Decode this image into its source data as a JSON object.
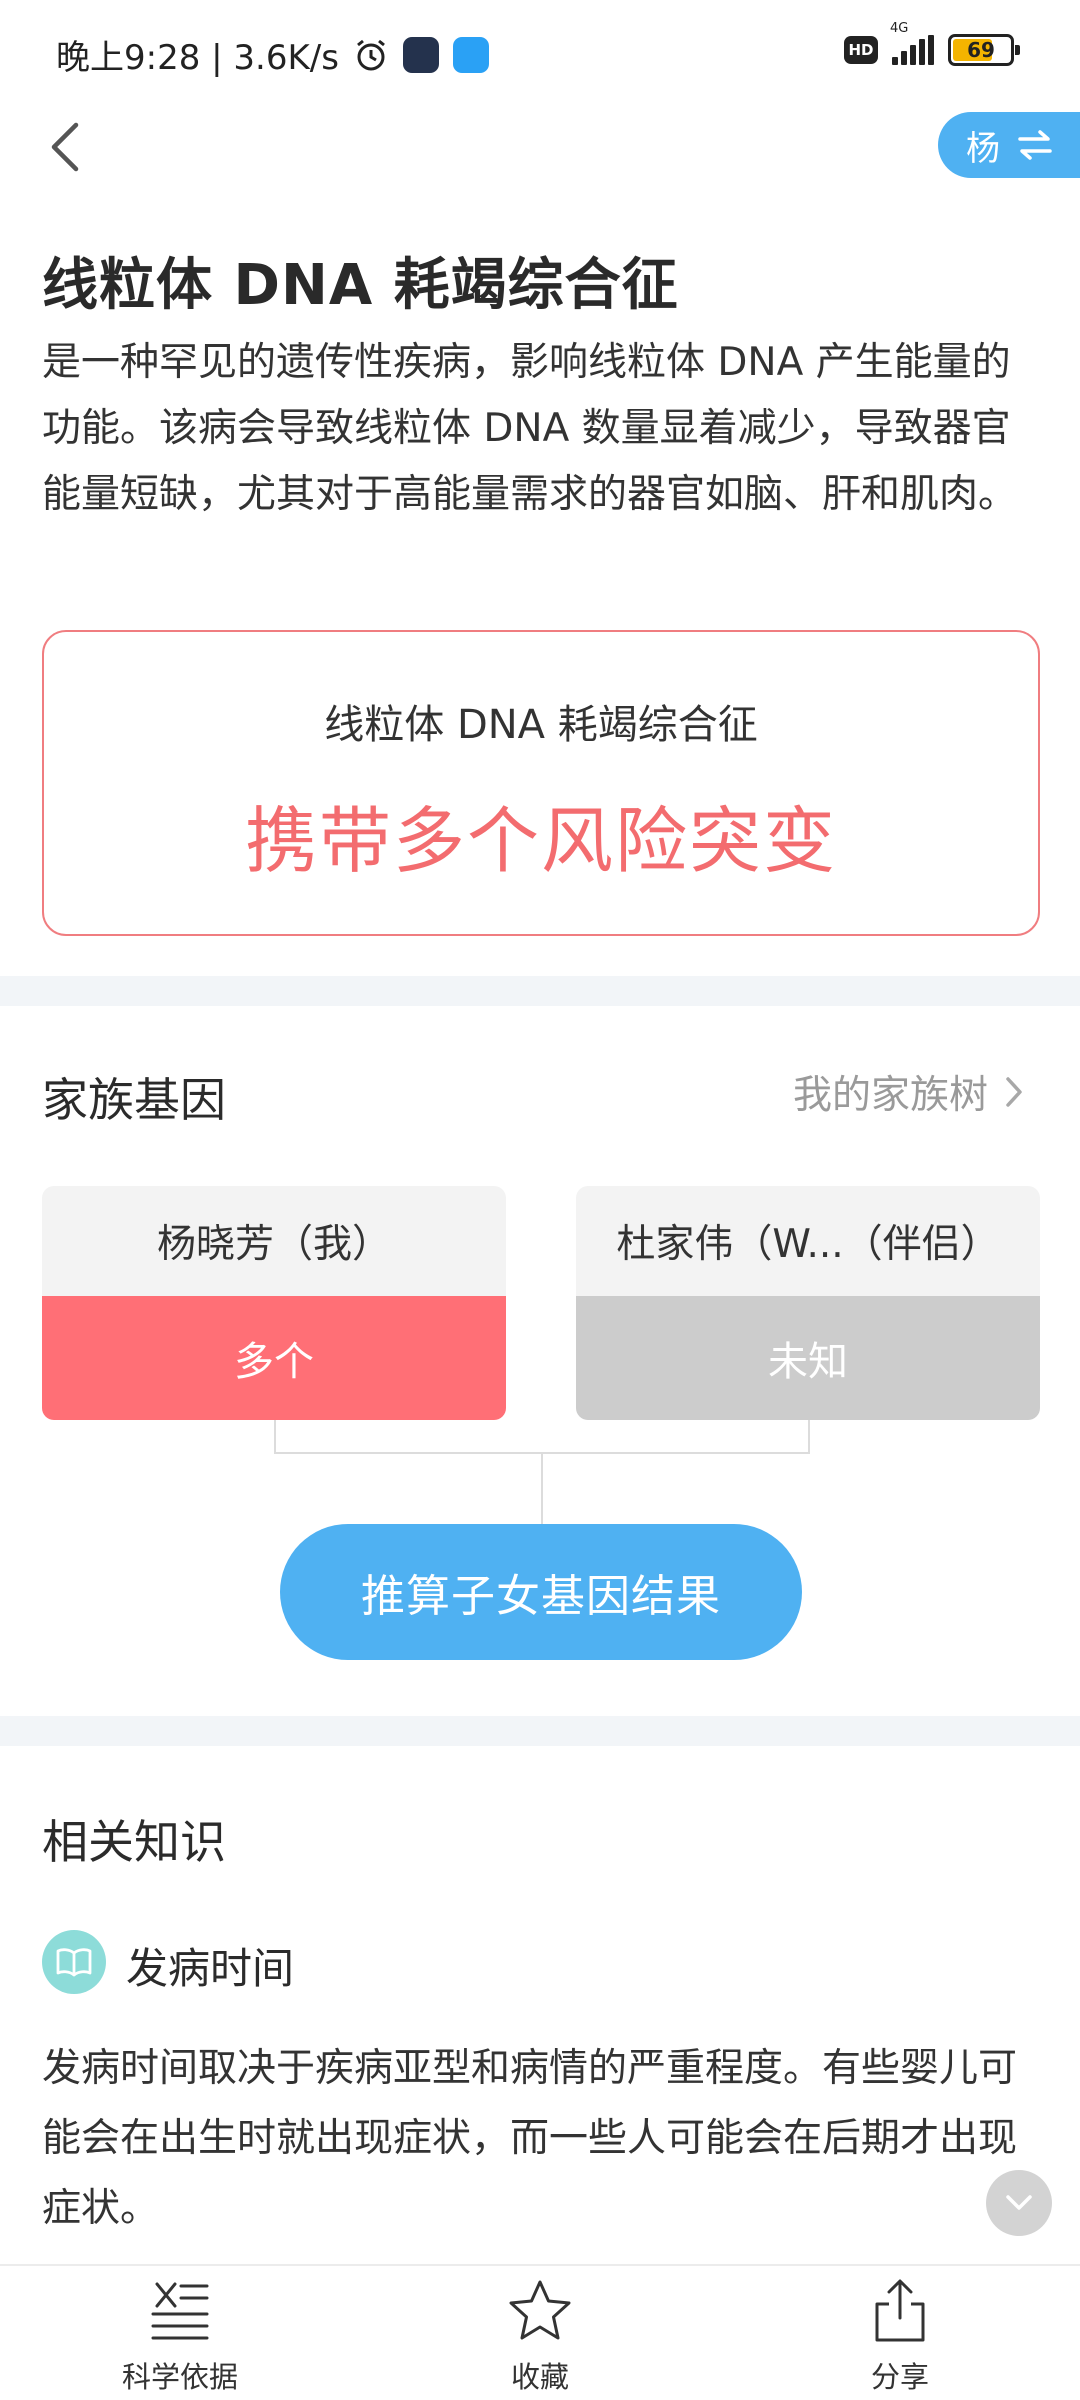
{
  "status_bar": {
    "time": "晚上9:28 | 3.6K/s",
    "hd": "HD",
    "network": "4G",
    "battery": "69",
    "battery_level": 0.69
  },
  "header": {
    "user_switch_label": "杨"
  },
  "disease": {
    "title": "线粒体 DNA 耗竭综合征",
    "description": "是一种罕见的遗传性疾病，影响线粒体 DNA 产生能量的功能。该病会导致线粒体 DNA 数量显着减少，导致器官能量短缺，尤其对于高能量需求的器官如脑、肝和肌肉。"
  },
  "risk_card": {
    "name": "线粒体 DNA 耗竭综合征",
    "status": "携带多个风险突变",
    "status_color": "#f36c6f"
  },
  "family": {
    "title": "家族基因",
    "tree_link": "我的家族树",
    "members": [
      {
        "name": "杨晓芳（我）",
        "status": "多个",
        "color": "#ff6f76"
      },
      {
        "name": "杜家伟（W...（伴侣）",
        "status": "未知",
        "color": "#cccccc"
      }
    ],
    "predict_button": "推算子女基因结果"
  },
  "knowledge": {
    "title": "相关知识",
    "items": [
      {
        "icon": "book-icon",
        "title": "发病时间",
        "text": "发病时间取决于疾病亚型和病情的严重程度。有些婴儿可能会在出生时就出现症状，而一些人可能会在后期才出现症状。"
      }
    ]
  },
  "bottom_tabs": [
    {
      "icon": "evidence-icon",
      "label": "科学依据"
    },
    {
      "icon": "star-icon",
      "label": "收藏"
    },
    {
      "icon": "share-icon",
      "label": "分享"
    }
  ],
  "colors": {
    "accent_blue": "#4fb1f2",
    "risk_red": "#f36c6f"
  }
}
